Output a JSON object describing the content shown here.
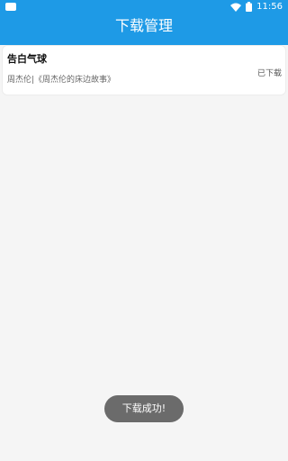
{
  "status_bar": {
    "time": "11:56",
    "left_icon": "notification-icon",
    "right_icons": [
      "wifi-icon",
      "battery-icon"
    ],
    "color": "#1e9ae6"
  },
  "header": {
    "title": "下载管理"
  },
  "downloads": [
    {
      "title": "告白气球",
      "meta": "周杰伦|《周杰伦的床边故事》",
      "status": "已下载"
    }
  ],
  "toast": {
    "message": "下载成功!"
  }
}
